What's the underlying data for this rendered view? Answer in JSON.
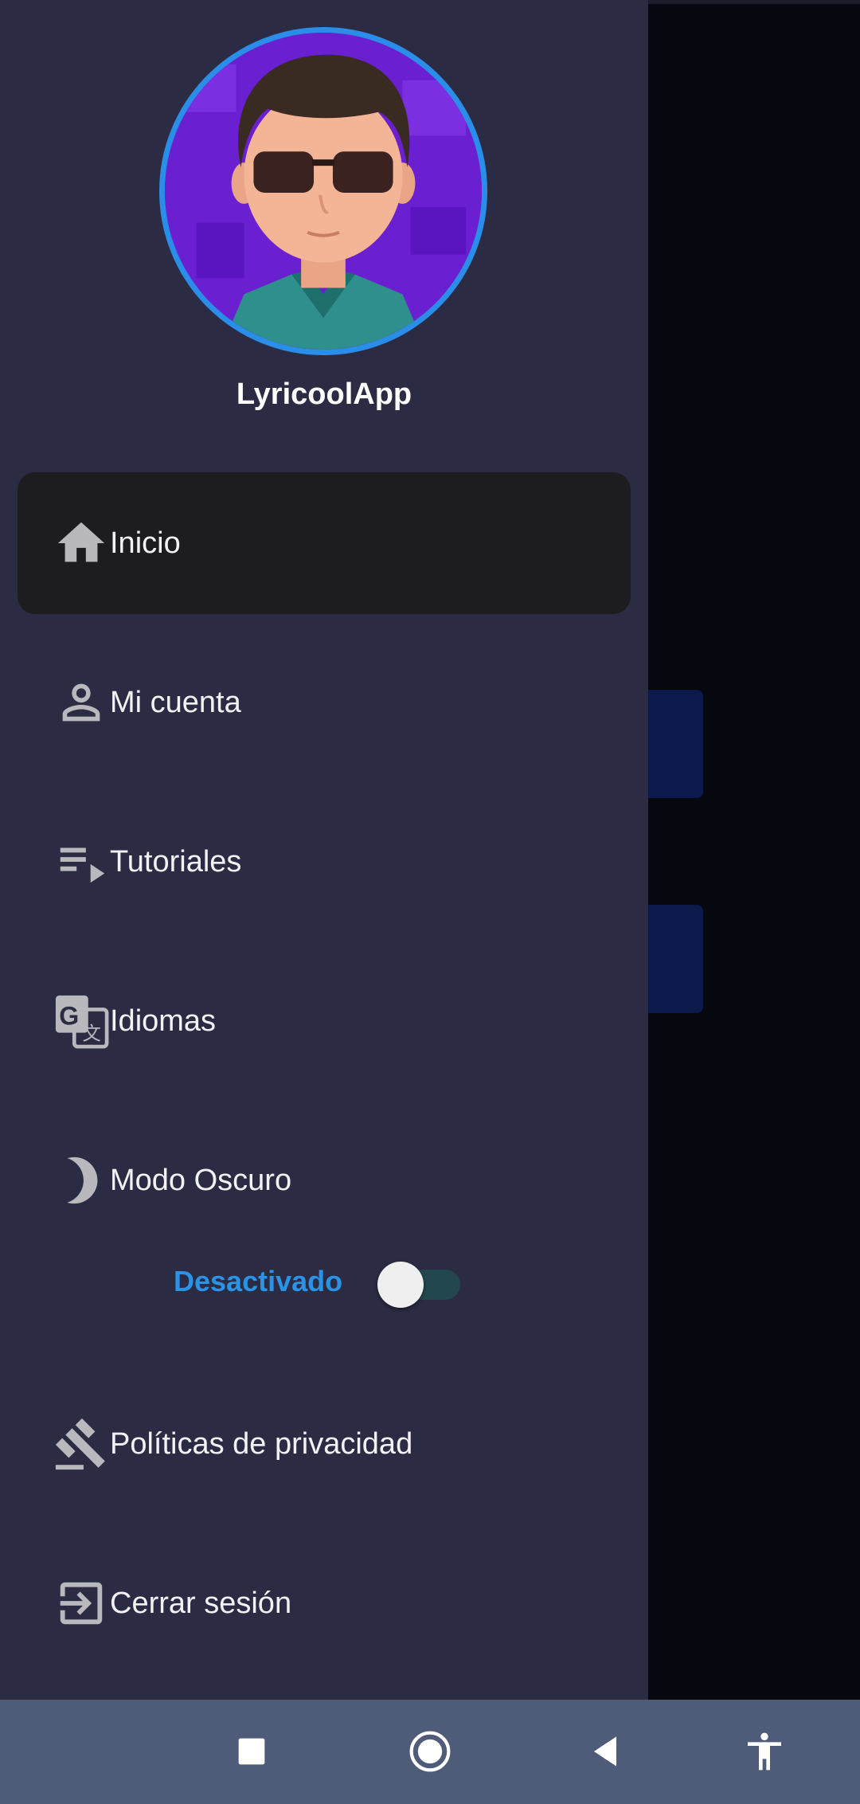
{
  "app": {
    "name": "LyricoolApp"
  },
  "menu": {
    "items": [
      {
        "label": "Inicio",
        "icon": "home-icon",
        "active": true
      },
      {
        "label": "Mi cuenta",
        "icon": "person-icon",
        "active": false
      },
      {
        "label": "Tutoriales",
        "icon": "playlist-icon",
        "active": false
      },
      {
        "label": "Idiomas",
        "icon": "translate-icon",
        "active": false
      },
      {
        "label": "Modo Oscuro",
        "icon": "moon-icon",
        "active": false
      },
      {
        "label": "Políticas de privacidad",
        "icon": "gavel-icon",
        "active": false
      },
      {
        "label": "Cerrar sesión",
        "icon": "logout-icon",
        "active": false
      }
    ]
  },
  "dark_mode": {
    "status_label": "Desactivado",
    "enabled": false
  },
  "navbar": {
    "buttons": [
      "recents-button",
      "home-button",
      "back-button",
      "accessibility-button"
    ]
  },
  "colors": {
    "drawer_bg": "#2b2c44",
    "active_item_bg": "#1d1d1f",
    "accent": "#2b93e6",
    "navbar_bg": "#4f5c79",
    "avatar_ring": "#2a8ee8"
  }
}
